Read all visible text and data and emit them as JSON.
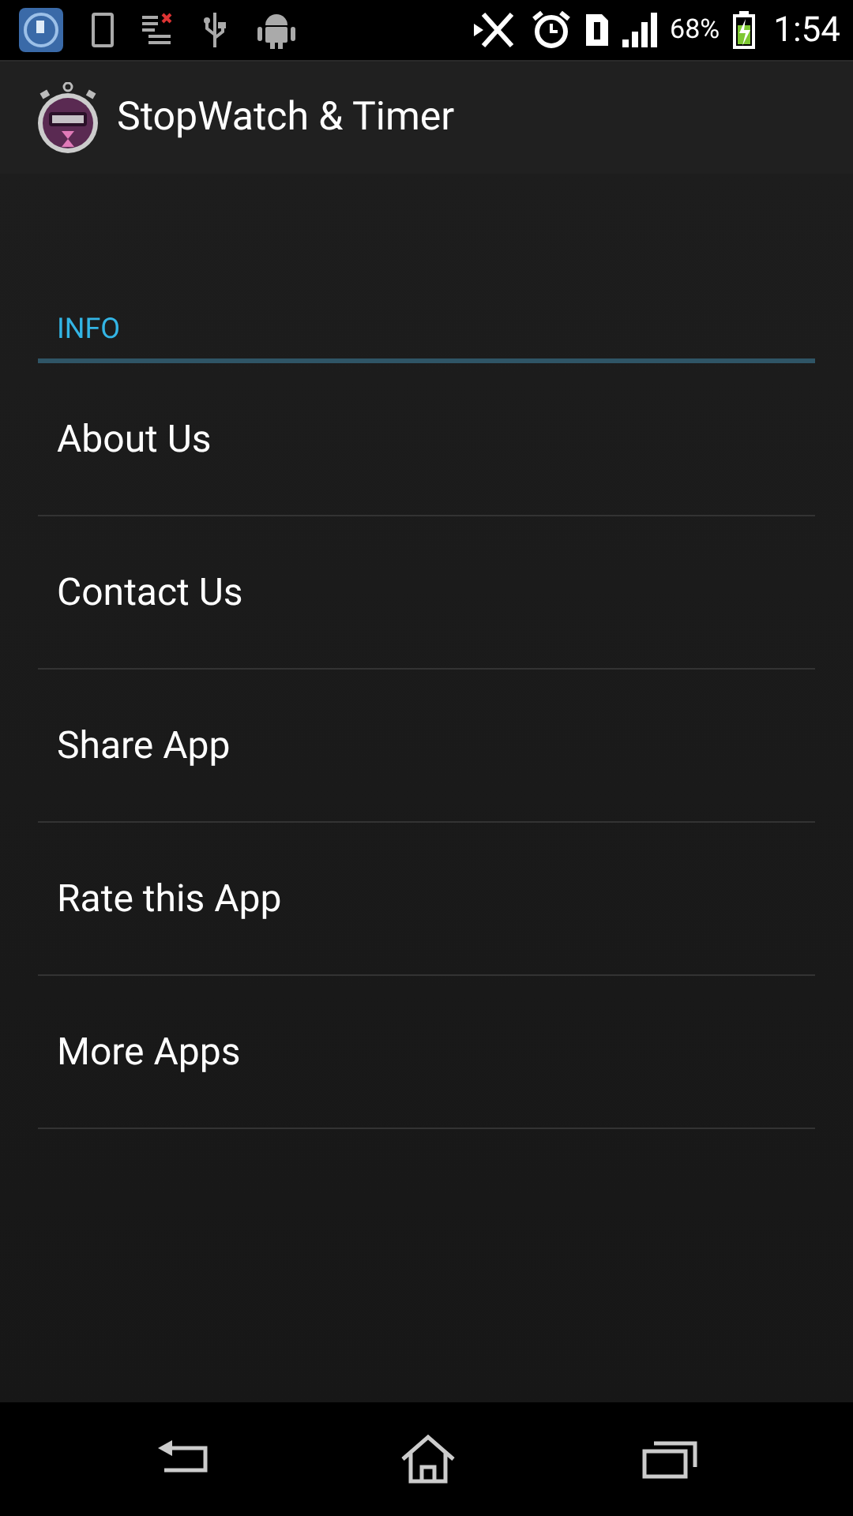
{
  "status_bar": {
    "battery": "68%",
    "time": "1:54"
  },
  "action_bar": {
    "title": "StopWatch & Timer"
  },
  "section": {
    "header": "INFO",
    "items": [
      {
        "label": "About Us"
      },
      {
        "label": "Contact Us"
      },
      {
        "label": "Share App"
      },
      {
        "label": "Rate this App"
      },
      {
        "label": "More Apps"
      }
    ]
  }
}
